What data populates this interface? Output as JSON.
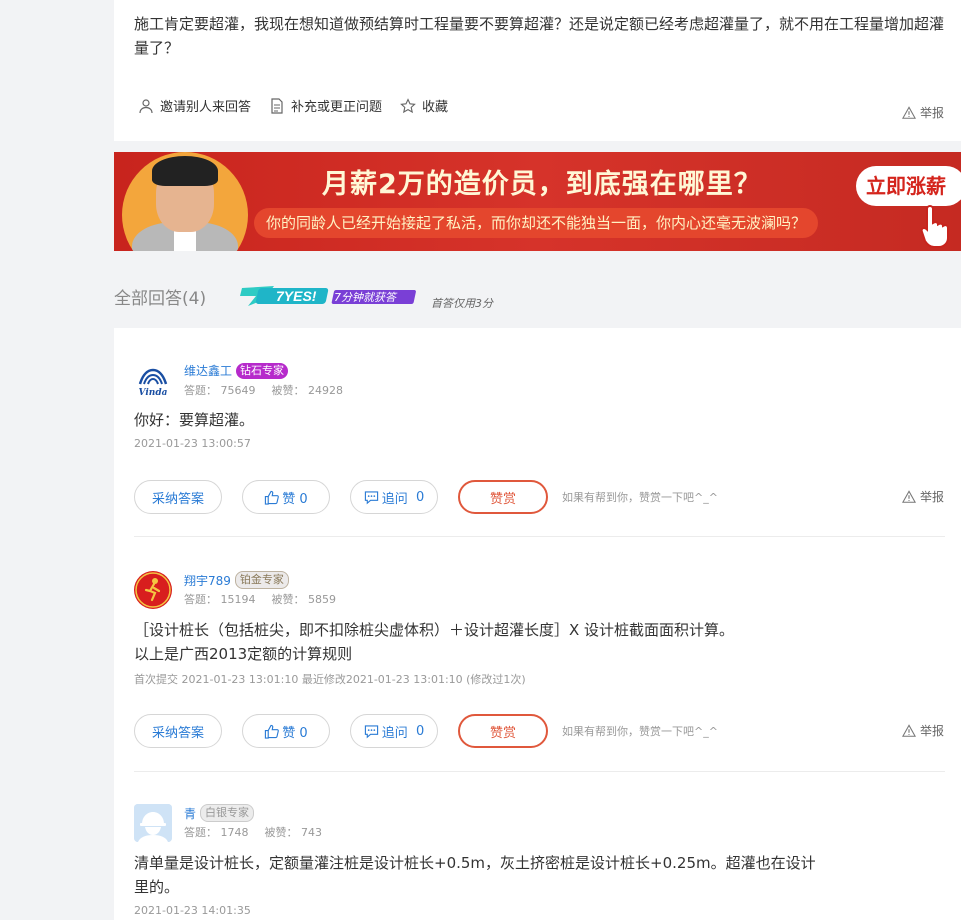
{
  "question": {
    "text": "施工肯定要超灌，我现在想知道做预结算时工程量要不要算超灌？还是说定额已经考虑超灌量了，就不用在工程量增加超灌量了？",
    "actions": {
      "invite": "邀请别人来回答",
      "supplement": "补充或更正问题",
      "favorite": "收藏"
    },
    "report": "举报"
  },
  "banner": {
    "title": "月薪2万的造价员，到底强在哪里？",
    "subtitle": "你的同龄人已经开始接起了私活，而你却还不能独当一面，你内心还毫无波澜吗？",
    "button": "立即涨薪"
  },
  "answers_header": {
    "title": "全部回答(4)",
    "badge_big": "7YES!",
    "badge_small": "7分钟就获答",
    "note": "首答仅用3分"
  },
  "answers": [
    {
      "name": "维达鑫工",
      "avatar_text": "Vinda",
      "tag": "钻石专家",
      "answer_count_label": "答题：",
      "answer_count": "75649",
      "liked_label": "被赞：",
      "liked_count": "24928",
      "content": "你好：要算超灌。",
      "time": "2021-01-23 13:00:57",
      "accept": "采纳答案",
      "like": "赞 0",
      "follow": "追问",
      "follow_count": "0",
      "reward": "赞赏",
      "hint": "如果有帮到你，赞赏一下吧^_^",
      "report": "举报"
    },
    {
      "name": "翔宇789",
      "tag": "铂金专家",
      "answer_count_label": "答题：",
      "answer_count": "15194",
      "liked_label": "被赞：",
      "liked_count": "5859",
      "content_line1": "［设计桩长（包括桩尖，即不扣除桩尖虚体积）＋设计超灌长度］X 设计桩截面面积计算。",
      "content_line2": "以上是广西2013定额的计算规则",
      "time": "首次提交 2021-01-23 13:01:10   最近修改2021-01-23 13:01:10 (修改过1次)",
      "accept": "采纳答案",
      "like": "赞 0",
      "follow": "追问",
      "follow_count": "0",
      "reward": "赞赏",
      "hint": "如果有帮到你，赞赏一下吧^_^",
      "report": "举报"
    },
    {
      "name": "青",
      "tag": "白银专家",
      "answer_count_label": "答题：",
      "answer_count": "1748",
      "liked_label": "被赞：",
      "liked_count": "743",
      "content_line1": "清单量是设计桩长，定额量灌注桩是设计桩长+0.5m，灰土挤密桩是设计桩长+0.25m。超灌也在设计",
      "content_line2": "里的。",
      "time": "2021-01-23 14:01:35"
    }
  ],
  "colors": {
    "link_blue": "#2a7bd5",
    "reward_red": "#e0583c",
    "diamond_tag": "#b62acb",
    "banner_red": "#c8241d"
  }
}
